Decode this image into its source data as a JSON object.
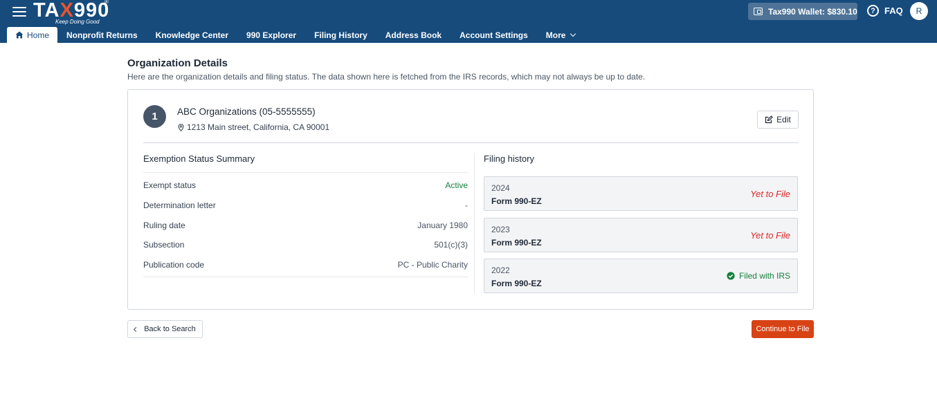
{
  "header": {
    "logo": {
      "text_main_1": "TA",
      "text_x": "X",
      "text_main_2": "990",
      "registered": "®",
      "tagline": "Keep Doing Good"
    },
    "wallet_label": "Tax990 Wallet: $830.10",
    "faq_label": "FAQ",
    "faq_icon_glyph": "?",
    "avatar_initial": "R",
    "brand_color": "#164b7c",
    "accent_color": "#e9542a"
  },
  "nav": {
    "items": [
      {
        "label": "Home",
        "icon": "home-icon",
        "active": true
      },
      {
        "label": "Nonprofit Returns"
      },
      {
        "label": "Knowledge Center"
      },
      {
        "label": "990 Explorer"
      },
      {
        "label": "Filing History"
      },
      {
        "label": "Address Book"
      },
      {
        "label": "Account Settings"
      },
      {
        "label": "More",
        "icon": "chevron-down-icon"
      }
    ]
  },
  "page": {
    "title": "Organization Details",
    "subtitle": "Here are the organization details and filing status. The data shown here is fetched from the IRS records, which may not always be up to date."
  },
  "organization": {
    "number": "1",
    "name": "ABC Organizations (05-5555555)",
    "address": "1213 Main street, California, CA 90001",
    "edit_label": "Edit"
  },
  "exemption": {
    "title": "Exemption Status Summary",
    "rows": [
      {
        "label": "Exempt status",
        "value": "Active"
      },
      {
        "label": "Determination letter",
        "value": "-"
      },
      {
        "label": "Ruling date",
        "value": "January 1980"
      },
      {
        "label": "Subsection",
        "value": "501(c)(3)"
      },
      {
        "label": "Publication code",
        "value": "PC - Public Charity"
      }
    ]
  },
  "filing_history": {
    "title": "Filing history",
    "entries": [
      {
        "year": "2024",
        "form": "Form 990-EZ",
        "status": "Yet to File"
      },
      {
        "year": "2023",
        "form": "Form 990-EZ",
        "status": "Yet to File"
      },
      {
        "year": "2022",
        "form": "Form 990-EZ",
        "status": "Filed with IRS"
      }
    ]
  },
  "actions": {
    "back_label": "Back to Search",
    "continue_label": "Continue to File",
    "continue_color": "#d84315"
  }
}
